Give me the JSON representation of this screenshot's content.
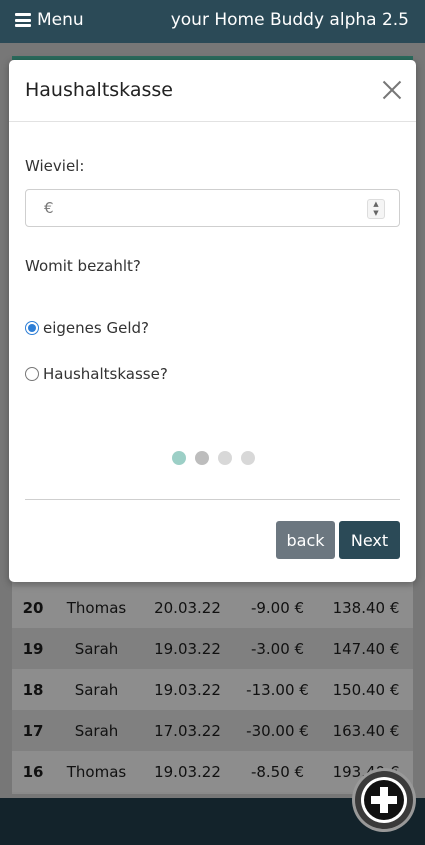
{
  "header": {
    "menu_label": "Menu",
    "app_title": "your Home Buddy alpha 2.5"
  },
  "modal": {
    "title": "Haushaltskasse",
    "amount_label": "Wieviel:",
    "currency_symbol": "€",
    "amount_value": "",
    "payment_question": "Womit bezahlt?",
    "options": [
      {
        "label": "eigenes Geld?",
        "selected": true
      },
      {
        "label": "Haushaltskasse?",
        "selected": false
      }
    ],
    "wizard_steps": 4,
    "current_step": 1,
    "back_label": "back",
    "next_label": "Next"
  },
  "table": {
    "rows": [
      {
        "id": "20",
        "name": "Thomas",
        "date": "20.03.22",
        "amount": "-9.00 €",
        "balance": "138.40 €"
      },
      {
        "id": "19",
        "name": "Sarah",
        "date": "19.03.22",
        "amount": "-3.00 €",
        "balance": "147.40 €"
      },
      {
        "id": "18",
        "name": "Sarah",
        "date": "19.03.22",
        "amount": "-13.00 €",
        "balance": "150.40 €"
      },
      {
        "id": "17",
        "name": "Sarah",
        "date": "17.03.22",
        "amount": "-30.00 €",
        "balance": "163.40 €"
      },
      {
        "id": "16",
        "name": "Thomas",
        "date": "19.03.22",
        "amount": "-8.50 €",
        "balance": "193.40 €"
      }
    ]
  },
  "icons": {
    "menu": "hamburger-icon",
    "close": "close-icon",
    "add": "plus-circle-icon"
  },
  "colors": {
    "header_bg": "#2b4a57",
    "next_button": "#2b4a57",
    "back_button": "#6c7780",
    "active_step": "#9ccfc6"
  }
}
